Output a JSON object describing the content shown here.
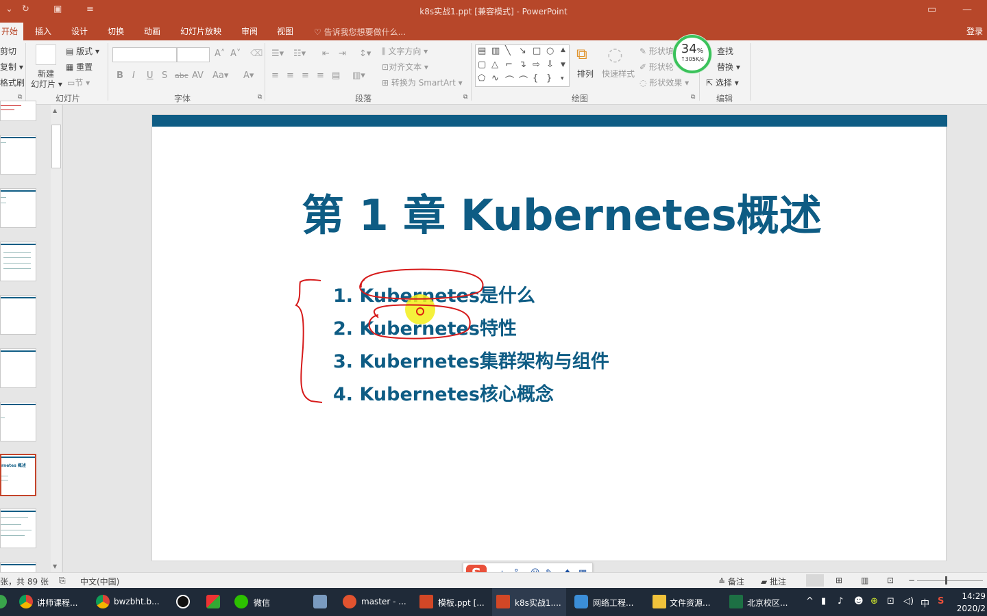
{
  "window": {
    "title": "k8s实战1.ppt [兼容模式] - PowerPoint"
  },
  "ribbon_tabs": [
    {
      "label": "开始",
      "active": true
    },
    {
      "label": "插入"
    },
    {
      "label": "设计"
    },
    {
      "label": "切换"
    },
    {
      "label": "动画"
    },
    {
      "label": "幻灯片放映"
    },
    {
      "label": "审阅"
    },
    {
      "label": "视图"
    }
  ],
  "tell_me": "告诉我您想要做什么...",
  "login": "登录",
  "clipboard": {
    "cut": "剪切",
    "copy": "复制",
    "format_painter": "格式刷"
  },
  "slides_group": {
    "new_slide": "新建",
    "new_slide2": "幻灯片",
    "layout": "版式",
    "reset": "重置",
    "section": "节",
    "label": "幻灯片"
  },
  "font_group": {
    "label": "字体"
  },
  "paragraph_group": {
    "text_direction": "文字方向",
    "align_text": "对齐文本",
    "convert_smartart": "转换为 SmartArt",
    "label": "段落"
  },
  "drawing_group": {
    "arrange": "排列",
    "quick_styles": "快速样式",
    "shape_fill": "形状填",
    "shape_outline": "形状轮",
    "shape_effects": "形状效果",
    "label": "绘图"
  },
  "editing_group": {
    "find": "查找",
    "replace": "替换",
    "select": "选择",
    "label": "编辑"
  },
  "speed_widget": {
    "percent": "34",
    "percent_sign": "%",
    "rate": "↑305K/s"
  },
  "slide": {
    "title": "第 1 章 Kubernetes概述",
    "items": [
      "1. Kubernetes是什么",
      "2. Kubernetes特性",
      "3. Kubernetes集群架构与组件",
      "4. Kubernetes核心概念"
    ],
    "accent_color": "#0e5c84"
  },
  "thumbnails": {
    "selected_title": "rnetes 概述"
  },
  "ime_bar": {
    "logo": "S",
    "mode": "中"
  },
  "status_bar": {
    "slide_count": "张，共 89 张",
    "language": "中文(中国)",
    "notes": "备注",
    "comments": "批注"
  },
  "taskbar": {
    "items": [
      {
        "label": "讲师课程...",
        "icon": "chrome-icon"
      },
      {
        "label": "bwzbht.b...",
        "icon": "chrome-icon"
      },
      {
        "label": "",
        "icon": "qq-icon"
      },
      {
        "label": "",
        "icon": "app-icon"
      },
      {
        "label": "微信",
        "icon": "wechat-icon"
      },
      {
        "label": "",
        "icon": "search-tool-icon"
      },
      {
        "label": "master - ...",
        "icon": "terminal-icon"
      },
      {
        "label": "模板.ppt [...",
        "icon": "powerpoint-icon"
      },
      {
        "label": "k8s实战1....",
        "icon": "powerpoint-icon"
      },
      {
        "label": "网络工程...",
        "icon": "shield-icon"
      },
      {
        "label": "文件资源...",
        "icon": "folder-icon"
      },
      {
        "label": "北京校区...",
        "icon": "excel-icon"
      }
    ],
    "ime_indicator": "中",
    "time": "14:29",
    "date": "2020/2"
  }
}
